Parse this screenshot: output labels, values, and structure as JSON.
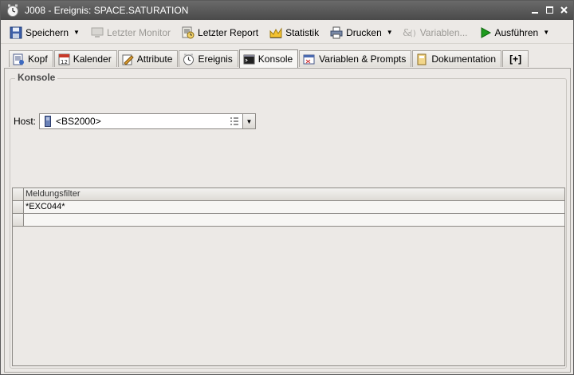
{
  "window": {
    "title": "J008 - Ereignis: SPACE.SATURATION"
  },
  "toolbar": {
    "save": "Speichern",
    "last_monitor": "Letzter Monitor",
    "last_report": "Letzter Report",
    "statistics": "Statistik",
    "print": "Drucken",
    "variables": "Variablen...",
    "execute": "Ausführen"
  },
  "tabs": [
    {
      "label": "Kopf"
    },
    {
      "label": "Kalender"
    },
    {
      "label": "Attribute"
    },
    {
      "label": "Ereignis"
    },
    {
      "label": "Konsole"
    },
    {
      "label": "Variablen & Prompts"
    },
    {
      "label": "Dokumentation"
    },
    {
      "label": "[+]"
    }
  ],
  "konsole": {
    "group_title": "Konsole",
    "host_label": "Host:",
    "host_value": "<BS2000>",
    "filter_header": "Meldungsfilter",
    "filters": [
      "*EXC044*",
      ""
    ]
  },
  "colors": {
    "titlebar": "#4a4a4a",
    "execute_green": "#1e9b1e",
    "background": "#ece9e6"
  }
}
